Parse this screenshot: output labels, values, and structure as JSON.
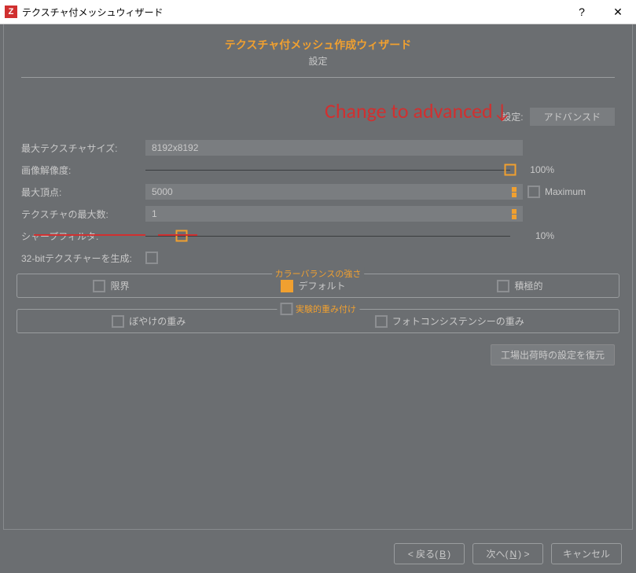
{
  "window": {
    "icon_letter": "Z",
    "title": "テクスチャ付メッシュウィザード"
  },
  "header": {
    "title": "テクスチャ付メッシュ作成ウィザード",
    "subtitle": "設定"
  },
  "annotation": "Change to advanced↓",
  "preset": {
    "label": "設定:",
    "value": "アドバンスド"
  },
  "fields": {
    "max_texture_size": {
      "label": "最大テクスチャサイズ:",
      "value": "8192x8192"
    },
    "image_resolution": {
      "label": "画像解像度:",
      "pct": "100%",
      "handle_pct": 100
    },
    "max_vertices": {
      "label": "最大頂点:",
      "value": "5000",
      "checkbox_label": "Maximum"
    },
    "max_textures": {
      "label": "テクスチャの最大数:",
      "value": "1"
    },
    "sharp_filter": {
      "label": "シャープフィルタ:",
      "pct": "10%",
      "handle_pct": 10
    },
    "gen_32bit": {
      "label": "32-bitテクスチャーを生成:"
    }
  },
  "color_group": {
    "legend": "カラーバランスの強さ",
    "opts": {
      "a": "限界",
      "b": "デフォルト",
      "c": "積極的"
    }
  },
  "weight_group": {
    "legend": "実験的重み付け",
    "opts": {
      "a": "ぼやけの重み",
      "b": "フォトコンシステンシーの重み"
    }
  },
  "reset_button": "工場出荷時の設定を復元",
  "footer": {
    "back_pre": "< 戻る(",
    "back_ak": "B",
    "back_post": ")",
    "next_pre": "次へ(",
    "next_ak": "N",
    "next_post": ") >",
    "cancel": "キャンセル"
  }
}
